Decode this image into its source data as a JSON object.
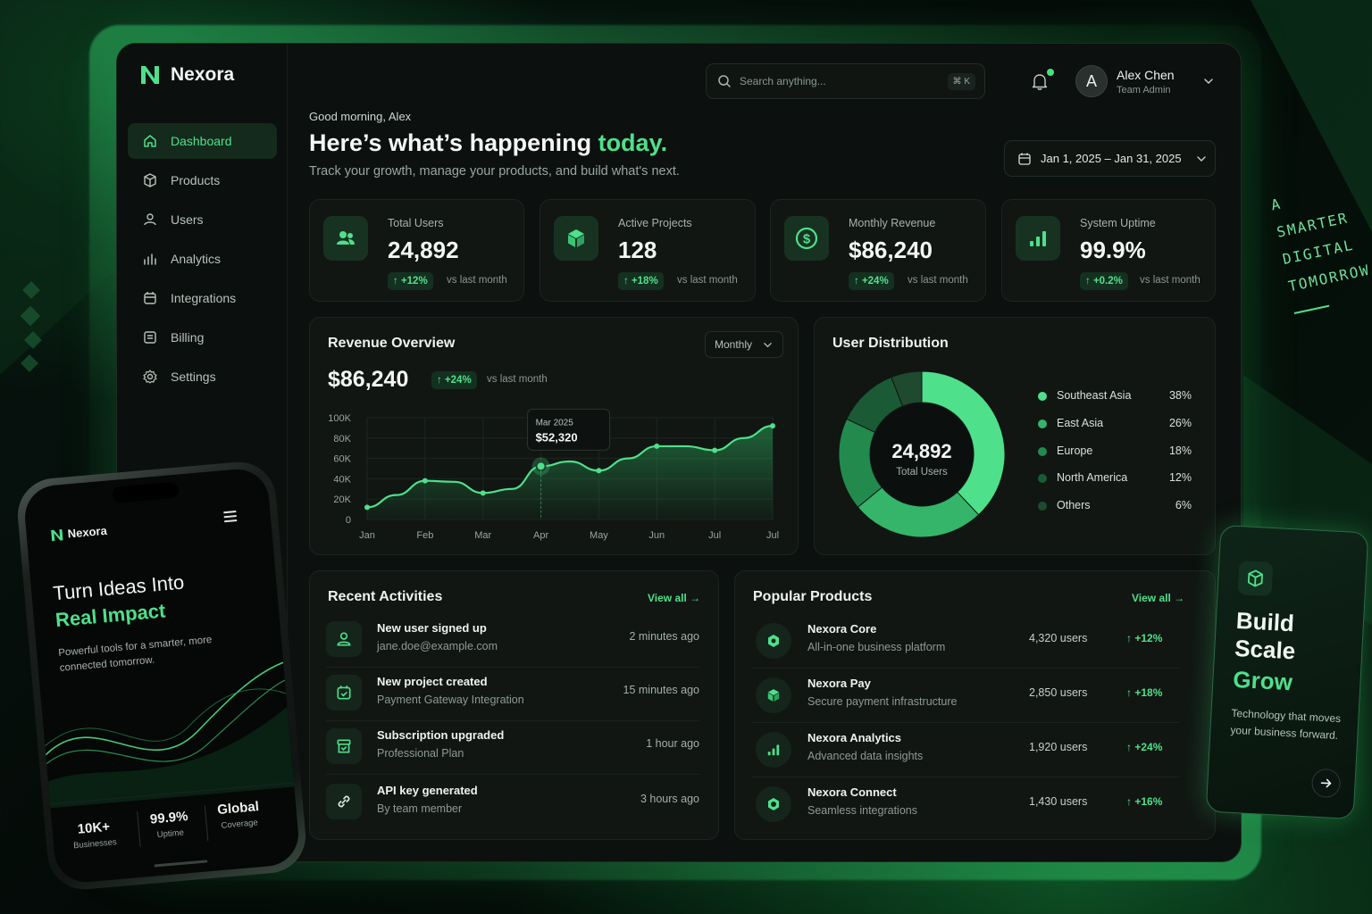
{
  "brand": {
    "name": "Nexora"
  },
  "sidebar": {
    "items": [
      {
        "label": "Dashboard",
        "icon": "home-icon",
        "active": true
      },
      {
        "label": "Products",
        "icon": "box-icon"
      },
      {
        "label": "Users",
        "icon": "user-icon"
      },
      {
        "label": "Analytics",
        "icon": "bar-chart-icon"
      },
      {
        "label": "Integrations",
        "icon": "calendar-icon"
      },
      {
        "label": "Billing",
        "icon": "receipt-icon"
      },
      {
        "label": "Settings",
        "icon": "gear-icon"
      }
    ]
  },
  "header": {
    "search_placeholder": "Search anything...",
    "search_shortcut": "⌘ K",
    "user_name": "Alex Chen",
    "user_role": "Team Admin",
    "avatar_initial": "A"
  },
  "hero": {
    "greeting": "Good morning, Alex",
    "headline": "Here’s what’s happening ",
    "headline_highlight": "today.",
    "subtitle": "Track your growth, manage your products, and build what's next.",
    "date_range": "Jan 1, 2025 – Jan 31, 2025"
  },
  "stats": [
    {
      "label": "Total Users",
      "value": "24,892",
      "delta": "↑ +12%",
      "vs": "vs last month",
      "icon": "users-icon"
    },
    {
      "label": "Active Projects",
      "value": "128",
      "delta": "↑ +18%",
      "vs": "vs last month",
      "icon": "cube-icon"
    },
    {
      "label": "Monthly Revenue",
      "value": "$86,240",
      "delta": "↑ +24%",
      "vs": "vs last month",
      "icon": "dollar-icon"
    },
    {
      "label": "System Uptime",
      "value": "99.9%",
      "delta": "↑ +0.2%",
      "vs": "vs last month",
      "icon": "signal-icon"
    }
  ],
  "revenue": {
    "title": "Revenue Overview",
    "period": "Monthly",
    "value": "$86,240",
    "delta": "↑ +24%",
    "vs": "vs last month",
    "tooltip_label": "Mar 2025",
    "tooltip_value": "$52,320"
  },
  "chart_data": {
    "type": "area",
    "title": "Revenue Overview",
    "x": [
      "Jan",
      "",
      "Feb",
      "",
      "Mar",
      "",
      "Apr",
      "",
      "May",
      "",
      "Jun",
      "",
      "Jul",
      "",
      "Jul"
    ],
    "tick_labels": [
      "Jan",
      "Feb",
      "Mar",
      "Apr",
      "May",
      "Jun",
      "Jul",
      "Jul"
    ],
    "points": [
      12000,
      24000,
      38000,
      37000,
      26000,
      30000,
      52320,
      57000,
      48000,
      60000,
      72000,
      72000,
      68000,
      80000,
      92000
    ],
    "y_ticks": [
      "100K",
      "80K",
      "60K",
      "40K",
      "20K",
      "0"
    ],
    "ylim": [
      0,
      100000
    ],
    "highlight_index": 6,
    "grid": true
  },
  "distribution": {
    "title": "User Distribution",
    "center_value": "24,892",
    "center_label": "Total Users",
    "segments": [
      {
        "name": "Southeast Asia",
        "pct": "38%",
        "value": 38,
        "color": "#4ee08a"
      },
      {
        "name": "East Asia",
        "pct": "26%",
        "value": 26,
        "color": "#34b56a"
      },
      {
        "name": "Europe",
        "pct": "18%",
        "value": 18,
        "color": "#238a4e"
      },
      {
        "name": "North America",
        "pct": "12%",
        "value": 12,
        "color": "#1a5a35"
      },
      {
        "name": "Others",
        "pct": "6%",
        "value": 6,
        "color": "#1f4a30"
      }
    ]
  },
  "activities": {
    "title": "Recent Activities",
    "view_all": "View all →",
    "items": [
      {
        "title": "New user signed up",
        "sub": "jane.doe@example.com",
        "time": "2 minutes ago"
      },
      {
        "title": "New project created",
        "sub": "Payment Gateway Integration",
        "time": "15 minutes ago"
      },
      {
        "title": "Subscription upgraded",
        "sub": "Professional Plan",
        "time": "1 hour ago"
      },
      {
        "title": "API key generated",
        "sub": "By team member",
        "time": "3 hours ago"
      }
    ]
  },
  "products": {
    "title": "Popular Products",
    "view_all": "View all →",
    "items": [
      {
        "name": "Nexora Core",
        "desc": "All-in-one business platform",
        "users": "4,320 users",
        "delta": "↑ +12%"
      },
      {
        "name": "Nexora Pay",
        "desc": "Secure payment infrastructure",
        "users": "2,850 users",
        "delta": "↑ +18%"
      },
      {
        "name": "Nexora Analytics",
        "desc": "Advanced data insights",
        "users": "1,920 users",
        "delta": "↑ +24%"
      },
      {
        "name": "Nexora Connect",
        "desc": "Seamless integrations",
        "users": "1,430 users",
        "delta": "↑ +16%"
      }
    ]
  },
  "phone": {
    "brand": "Nexora",
    "title_line1": "Turn Ideas Into",
    "title_line2": "Real Impact",
    "body": "Powerful tools for a smarter, more connected tomorrow.",
    "stats": [
      {
        "value": "10K+",
        "label": "Businesses"
      },
      {
        "value": "99.9%",
        "label": "Uptime"
      },
      {
        "value": "Global",
        "label": "Coverage"
      }
    ]
  },
  "promo": {
    "line1": "Build",
    "line2": "Scale",
    "line3": "Grow",
    "body": "Technology that moves your business forward."
  },
  "tagline": [
    "A",
    "SMARTER",
    "DIGITAL",
    "TOMORROW"
  ],
  "colors": {
    "accent": "#4ee08a",
    "background": "#0c100e",
    "card": "#111613"
  }
}
